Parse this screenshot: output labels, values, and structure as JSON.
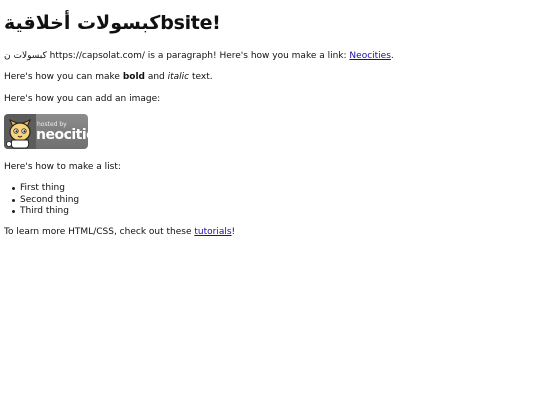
{
  "heading": "كبسولات أخلاقيةbsite!",
  "intro": {
    "prefix": "كبسولات ن https://capsolat.com/ is a paragraph! Here's how you make a link: ",
    "link_label": "Neocities",
    "suffix": "."
  },
  "bold_line": {
    "prefix": "Here's how you can make ",
    "bold": "bold",
    "middle": " and ",
    "italic": "italic",
    "suffix": " text."
  },
  "image_line": "Here's how you can add an image:",
  "badge": {
    "hosted": "hosted by",
    "brand": "neocities"
  },
  "list_intro": "Here's how to make a list:",
  "list_items": [
    "First thing",
    "Second thing",
    "Third thing"
  ],
  "closing": {
    "prefix": "To learn more HTML/CSS, check out these ",
    "link_label": "tutorials",
    "suffix": "!"
  }
}
